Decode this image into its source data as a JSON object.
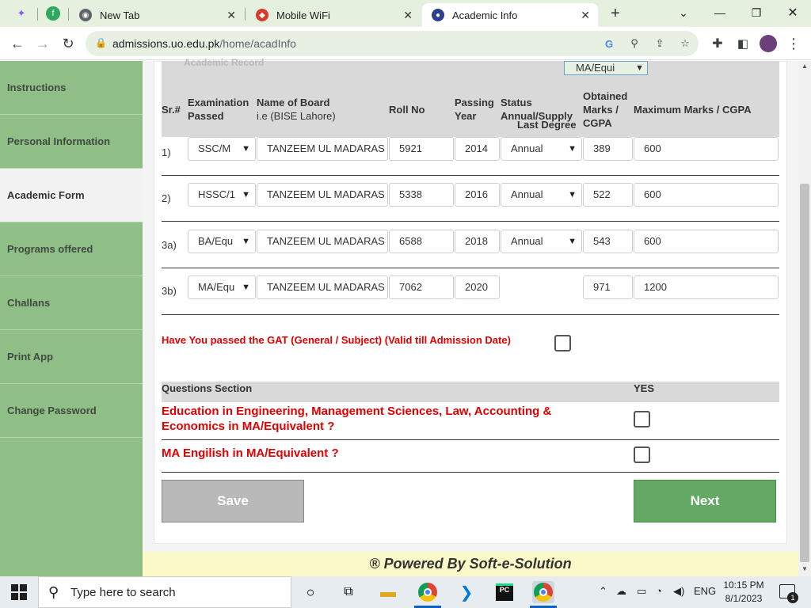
{
  "browser": {
    "tabs": [
      {
        "title": "New Tab"
      },
      {
        "title": "Mobile WiFi"
      },
      {
        "title": "Academic Info"
      }
    ],
    "new_tab_symbol": "+",
    "close_symbol": "✕",
    "url_host": "admissions.uo.edu.pk",
    "url_path": "/home/acadInfo"
  },
  "sidebar": {
    "items": [
      {
        "label": "Instructions"
      },
      {
        "label": "Personal Information"
      },
      {
        "label": "Academic Form"
      },
      {
        "label": "Programs offered"
      },
      {
        "label": "Challans"
      },
      {
        "label": "Print App"
      },
      {
        "label": "Change Password"
      }
    ],
    "active_index": 2
  },
  "form": {
    "cut_label": "Academic Record",
    "last_degree_label": "Last Degree",
    "last_degree_value": "MA/Equi",
    "headers": {
      "sr": "Sr.#",
      "exam_1": "Examination",
      "exam_2": "Passed",
      "board_1": "Name of Board",
      "board_2": "i.e (BISE Lahore)",
      "roll": "Roll No",
      "year_1": "Passing",
      "year_2": "Year",
      "status_1": "Status",
      "status_2": "Annual/Supply",
      "obt_1": "Obtained",
      "obt_2": "Marks /",
      "obt_3": "CGPA",
      "max": "Maximum Marks / CGPA"
    },
    "rows": [
      {
        "sr": "1)",
        "exam": "SSC/M",
        "board": "TANZEEM UL MADARAS",
        "roll": "5921",
        "year": "2014",
        "status": "Annual",
        "obtained": "389",
        "max": "600"
      },
      {
        "sr": "2)",
        "exam": "HSSC/1",
        "board": "TANZEEM UL MADARAS",
        "roll": "5338",
        "year": "2016",
        "status": "Annual",
        "obtained": "522",
        "max": "600"
      },
      {
        "sr": "3a)",
        "exam": "BA/Equ",
        "board": "TANZEEM UL MADARAS",
        "roll": "6588",
        "year": "2018",
        "status": "Annual",
        "obtained": "543",
        "max": "600"
      },
      {
        "sr": "3b)",
        "exam": "MA/Equ",
        "board": "TANZEEM UL MADARAS",
        "roll": "7062",
        "year": "2020",
        "status": "",
        "obtained": "971",
        "max": "1200"
      }
    ],
    "gat_question": "Have You passed the GAT (General / Subject) (Valid till Admission Date)",
    "questions_title": "Questions Section",
    "yes_label": "YES",
    "question_1": "Education in Engineering, Management Sciences, Law, Accounting & Economics in MA/Equivalent ?",
    "question_2": "MA Engilish in MA/Equivalent ?",
    "save_label": "Save",
    "next_label": "Next"
  },
  "footer": {
    "text": "® Powered By Soft-e-Solution"
  },
  "taskbar": {
    "search_placeholder": "Type here to search",
    "lang": "ENG",
    "time": "10:15 PM",
    "date": "8/1/2023",
    "notif_count": "1"
  },
  "colors": {
    "sidebar": "#8fbf87",
    "accent_red": "#e00000",
    "next_button": "#63a863",
    "footer_bg": "#fbf9c8"
  }
}
